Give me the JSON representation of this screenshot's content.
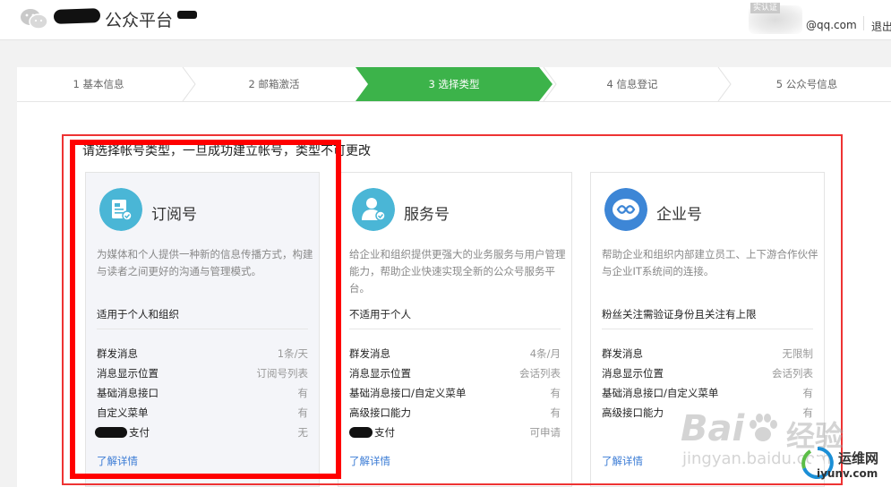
{
  "header": {
    "title": "公众平台",
    "avatar_tag": "实认证",
    "email": "@qq.com",
    "logout": "退出"
  },
  "steps": [
    {
      "label": "1 基本信息",
      "active": false
    },
    {
      "label": "2 邮箱激活",
      "active": false
    },
    {
      "label": "3 选择类型",
      "active": true
    },
    {
      "label": "4 信息登记",
      "active": false
    },
    {
      "label": "5 公众号信息",
      "active": false
    }
  ],
  "intro": "请选择帐号类型，一旦成功建立帐号，类型不可更改",
  "cards": [
    {
      "title": "订阅号",
      "icon": "subscription-account-icon",
      "desc": "为媒体和个人提供一种新的信息传播方式，构建与读者之间更好的沟通与管理模式。",
      "note": "适用于个人和组织",
      "features": [
        {
          "key": "群发消息",
          "value": "1条/天"
        },
        {
          "key": "消息显示位置",
          "value": "订阅号列表"
        },
        {
          "key": "基础消息接口",
          "value": "有"
        },
        {
          "key": "自定义菜单",
          "value": "有"
        },
        {
          "key": "支付",
          "value": "无"
        }
      ],
      "more": "了解详情"
    },
    {
      "title": "服务号",
      "icon": "service-account-icon",
      "desc": "给企业和组织提供更强大的业务服务与用户管理能力，帮助企业快速实现全新的公众号服务平台。",
      "note": "不适用于个人",
      "features": [
        {
          "key": "群发消息",
          "value": "4条/月"
        },
        {
          "key": "消息显示位置",
          "value": "会话列表"
        },
        {
          "key": "基础消息接口/自定义菜单",
          "value": "有"
        },
        {
          "key": "高级接口能力",
          "value": "有"
        },
        {
          "key": "支付",
          "value": "可申请"
        }
      ],
      "more": "了解详情"
    },
    {
      "title": "企业号",
      "icon": "enterprise-account-icon",
      "desc": "帮助企业和组织内部建立员工、上下游合作伙伴与企业IT系统间的连接。",
      "note": "粉丝关注需验证身份且关注有上限",
      "features": [
        {
          "key": "群发消息",
          "value": "无限制"
        },
        {
          "key": "消息显示位置",
          "value": "会话列表"
        },
        {
          "key": "基础消息接口/自定义菜单",
          "value": "有"
        },
        {
          "key": "高级接口能力",
          "value": "有"
        }
      ],
      "more": "了解详情"
    }
  ],
  "watermark": {
    "baidu": "Bai",
    "baidu_cn": "经验",
    "url": "jingyan.baidu.com",
    "site_name": "运维网",
    "site_url": "iyunv.com"
  },
  "colors": {
    "step_active": "#3cb34a",
    "link": "#3a7bd5",
    "icon_bg": "#4ab6d6",
    "annotation": "#ff0000"
  }
}
